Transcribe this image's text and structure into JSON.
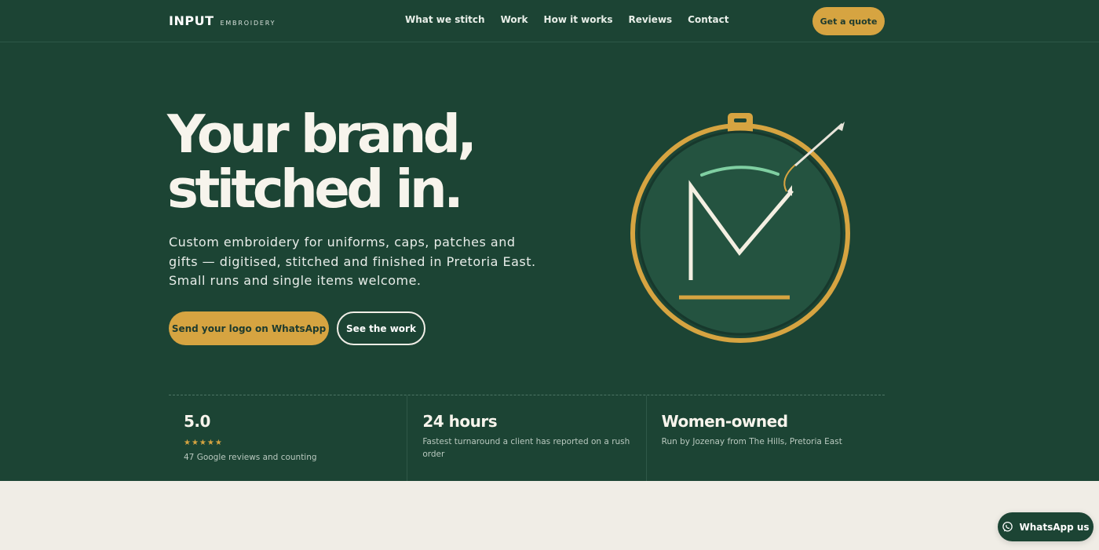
{
  "brand": {
    "name": "INPUT",
    "tagline": "EMBROIDERY"
  },
  "nav": {
    "items": [
      "What we stitch",
      "Work",
      "How it works",
      "Reviews",
      "Contact"
    ],
    "cta": "Get a quote"
  },
  "hero": {
    "headline": [
      "Your brand,",
      "stitched in."
    ],
    "description": "Custom embroidery for uniforms, caps, patches and gifts — digitised, stitched and finished in Pretoria East. Small runs and single items welcome.",
    "primary_button": "Send your logo on WhatsApp",
    "secondary_button": "See the work",
    "emblem_icon": "embroidery-hoop-monogram-icon"
  },
  "stats": [
    {
      "value": "5.0",
      "stars": "★★★★★",
      "rating": 5,
      "description": "47 Google reviews and counting"
    },
    {
      "value": "24 hours",
      "description": "Fastest turnaround a client has reported on a rush order"
    },
    {
      "value": "Women-owned",
      "description": "Run by Jozenay from The Hills, Pretoria East"
    }
  ],
  "floating": {
    "whatsapp_label": "WhatsApp us",
    "icon": "whatsapp-icon"
  },
  "colors": {
    "hero_bg": "#1c4434",
    "accent": "#d6a441",
    "page_bg": "#f0ede6",
    "text_light": "#f7f4ec"
  }
}
